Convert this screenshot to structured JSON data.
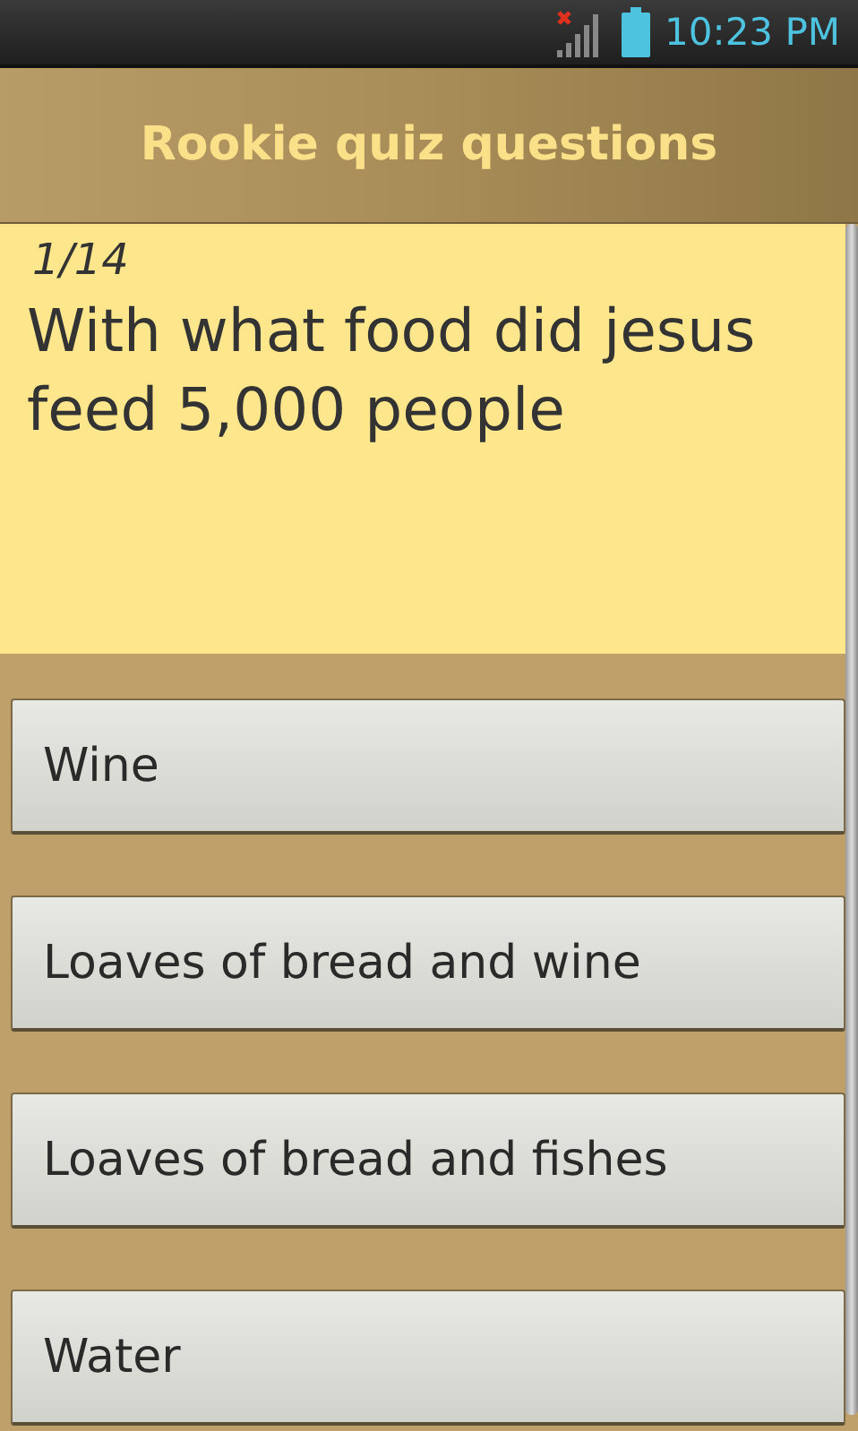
{
  "status_bar": {
    "time": "10:23 PM"
  },
  "title": "Rookie quiz questions",
  "question": {
    "counter": "1/14",
    "text": "With what food did jesus feed 5,000 people"
  },
  "answers": [
    {
      "label": "Wine"
    },
    {
      "label": "Loaves of bread and wine"
    },
    {
      "label": "Loaves of bread and fishes"
    },
    {
      "label": "Water"
    }
  ]
}
